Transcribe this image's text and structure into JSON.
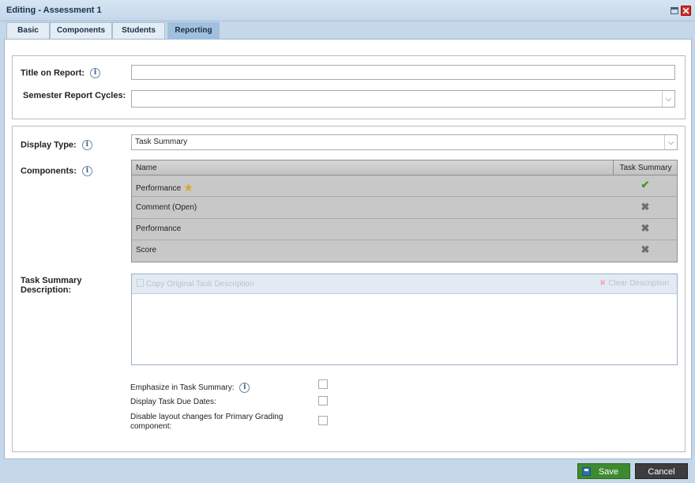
{
  "window": {
    "title": "Editing - Assessment 1",
    "close_glyph": "✕"
  },
  "tabs": [
    {
      "label": "Basic"
    },
    {
      "label": "Components"
    },
    {
      "label": "Students"
    },
    {
      "label": "Reporting",
      "active": true
    }
  ],
  "report_section": {
    "title_label": "Title on Report:",
    "title_value": "",
    "cycles_label": "Semester Report Cycles:",
    "cycles_value": ""
  },
  "display": {
    "display_type_label": "Display Type:",
    "display_type_value": "Task Summary",
    "components_label": "Components:"
  },
  "components_grid": {
    "columns": [
      "Name",
      "Task Summary"
    ],
    "rows": [
      {
        "name": "Performance",
        "starred": true,
        "task_summary": true
      },
      {
        "name": "Comment (Open)",
        "starred": false,
        "task_summary": false
      },
      {
        "name": "Performance",
        "starred": false,
        "task_summary": false
      },
      {
        "name": "Score",
        "starred": false,
        "task_summary": false
      }
    ]
  },
  "task_summary_description": {
    "label_line1": "Task Summary",
    "label_line2": "Description:",
    "copy_button": "Copy Original Task Description",
    "clear_button": "Clear Description"
  },
  "options": {
    "emphasize_label": "Emphasize in Task Summary:",
    "emphasize_checked": false,
    "due_dates_label": "Display Task Due Dates:",
    "due_dates_checked": false,
    "disable_layout_line1": "Disable layout changes for Primary Grading",
    "disable_layout_line2": "component:",
    "disable_layout_checked": false
  },
  "footer": {
    "save_label": "Save",
    "cancel_label": "Cancel"
  },
  "icons": {
    "info": "i",
    "check": "✔",
    "x": "✖",
    "star": "★",
    "dropdown": "⌵"
  },
  "colors": {
    "active_tab": "#9fc0de",
    "save_button": "#3f8a2f",
    "cancel_button": "#3d3d3d",
    "check": "#3d9a1b",
    "close": "#d22b2b"
  }
}
